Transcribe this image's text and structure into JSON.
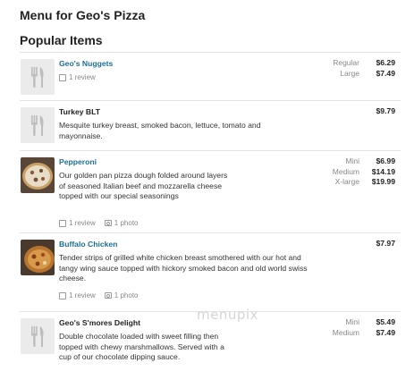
{
  "page": {
    "title": "Menu for Geo's Pizza",
    "section": "Popular Items"
  },
  "items": [
    {
      "name": "Geo's Nuggets",
      "desc": "",
      "reviews": "1 review",
      "photos": "",
      "thumb": "placeholder-icon",
      "prices": [
        {
          "label": "Regular",
          "value": "$6.29"
        },
        {
          "label": "Large",
          "value": "$7.49"
        }
      ]
    },
    {
      "name": "Turkey BLT",
      "desc": "Mesquite turkey breast, smoked bacon, lettuce, tomato and mayonnaise.",
      "reviews": "",
      "photos": "",
      "thumb": "placeholder-icon",
      "prices": [
        {
          "label": "",
          "value": "$9.79"
        }
      ]
    },
    {
      "name": "Pepperoni",
      "desc": "Our golden pan pizza dough folded around layers of seasoned Italian beef and mozzarella cheese topped with our special seasonings",
      "reviews": "1 review",
      "photos": "1 photo",
      "thumb": "pizza-photo",
      "prices": [
        {
          "label": "Mini",
          "value": "$6.99"
        },
        {
          "label": "Medium",
          "value": "$14.19"
        },
        {
          "label": "X-large",
          "value": "$19.99"
        }
      ]
    },
    {
      "name": "Buffalo Chicken",
      "desc": "Tender strips of grilled white chicken breast smothered with our hot and tangy wing sauce topped with hickory smoked bacon and old world swiss cheese.",
      "reviews": "1 review",
      "photos": "1 photo",
      "thumb": "pizza-photo",
      "prices": [
        {
          "label": "",
          "value": "$7.97"
        }
      ]
    },
    {
      "name": "Geo's S'mores Delight",
      "desc": "Double chocolate loaded with sweet filling then topped with chewy marshmallows. Served with a cup of our chocolate dipping sauce.",
      "reviews": "",
      "photos": "",
      "thumb": "placeholder-icon",
      "prices": [
        {
          "label": "Mini",
          "value": "$5.49"
        },
        {
          "label": "Medium",
          "value": "$7.49"
        }
      ]
    }
  ],
  "watermark": "menupix",
  "colors": {
    "link": "#1d6f91",
    "text": "#222222",
    "muted": "#888888",
    "divider": "#e3e3e3"
  }
}
